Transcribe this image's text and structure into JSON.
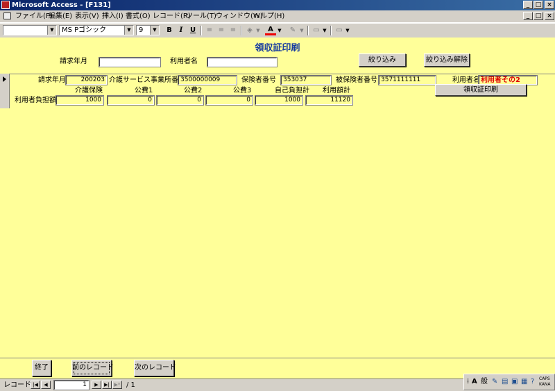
{
  "window": {
    "title": "Microsoft Access - [F131]",
    "controls": [
      "_",
      "□",
      "×"
    ],
    "doc_controls": [
      "_",
      "□",
      "×"
    ]
  },
  "menu": [
    "ファイル(F)",
    "編集(E)",
    "表示(V)",
    "挿入(I)",
    "書式(O)",
    "レコード(R)",
    "ツール(T)",
    "ウィンドウ(W)",
    "ヘルプ(H)"
  ],
  "toolbar": {
    "object_combo": "",
    "font_name": "MS Pゴシック",
    "font_size": "9",
    "bold": "B",
    "italic": "I",
    "underline": "U",
    "align_left": "≡",
    "align_center": "≡",
    "align_right": "≡",
    "fill_color": "◈",
    "font_color": "A",
    "line_color": "✎",
    "border_width": "▭",
    "special_effect": "▭"
  },
  "form": {
    "title": "領収証印刷",
    "filter": {
      "billing_month_label": "請求年月",
      "billing_month_value": "",
      "user_name_label": "利用者名",
      "user_name_value": "",
      "apply_button": "絞り込み",
      "clear_button": "絞り込み解除"
    },
    "record": {
      "billing_month_label": "請求年月",
      "billing_month": "200203",
      "provider_number_label": "介護サービス事業所番号",
      "provider_number": "3500000009",
      "insurer_number_label": "保険者番号",
      "insurer_number": "353037",
      "insured_number_label": "被保険者番号",
      "insured_number": "3571111111",
      "user_name_label": "利用者名",
      "user_name": "利用者その2",
      "print_button": "領収証印刷",
      "care_insurance_label": "介護保険",
      "public1_label": "公費1",
      "public2_label": "公費2",
      "public3_label": "公費3",
      "self_pay_label": "自己負担計",
      "total_label": "利用額計",
      "user_burden_label": "利用者負担額",
      "care_insurance": "1000",
      "public1": "0",
      "public2": "0",
      "public3": "0",
      "self_pay": "1000",
      "total": "11120"
    },
    "footer": {
      "exit_button": "終了",
      "prev_button": "前のレコード",
      "next_button": "次のレコード"
    }
  },
  "navigation": {
    "label": "レコード:",
    "current": "1",
    "total": "/ 1",
    "first": "|◀",
    "prev": "◀",
    "next": "▶",
    "last": "▶|",
    "new": "▶*"
  },
  "tray": {
    "ime_mode": "般",
    "caps": "CAPS",
    "kana": "KANA"
  }
}
